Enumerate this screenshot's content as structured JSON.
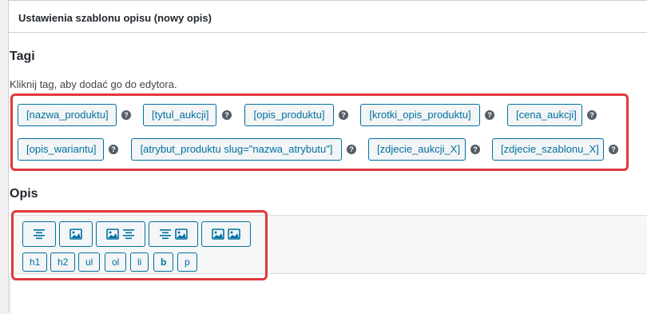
{
  "panel": {
    "title": "Ustawienia szablonu opisu (nowy opis)"
  },
  "tags_section": {
    "title": "Tagi",
    "hint": "Kliknij tag, aby dodać go do edytora.",
    "help_glyph": "?",
    "tags": [
      "[nazwa_produktu]",
      "[tytul_aukcji]",
      "[opis_produktu]",
      "[krotki_opis_produktu]",
      "[cena_aukcji]",
      "[opis_wariantu]",
      "[atrybut_produktu slug=\"nazwa_atrybutu\"]",
      "[zdjecie_aukcji_X]",
      "[zdjecie_szablonu_X]"
    ]
  },
  "description_section": {
    "title": "Opis",
    "layout_buttons": [
      "align-center-icon",
      "image-icon",
      "image-text-icon",
      "text-image-icon",
      "two-images-icon"
    ],
    "format_buttons": [
      "h1",
      "h2",
      "ul",
      "ol",
      "li",
      "b",
      "p"
    ]
  },
  "colors": {
    "accent": "#0071a1",
    "highlight": "#e0383e",
    "help_icon": "#555d66"
  }
}
